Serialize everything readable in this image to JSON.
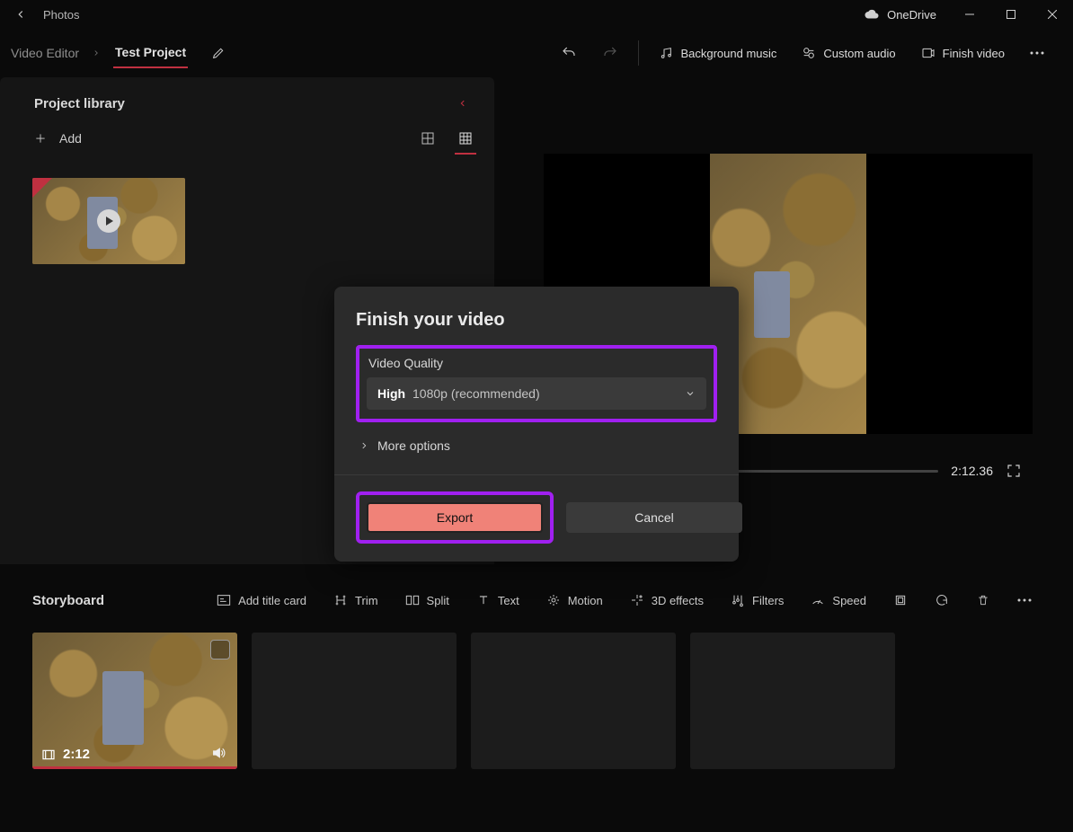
{
  "titlebar": {
    "app": "Photos",
    "onedrive": "OneDrive"
  },
  "breadcrumb": {
    "root": "Video Editor",
    "project": "Test Project"
  },
  "commands": {
    "bg_music": "Background music",
    "custom_audio": "Custom audio",
    "finish_video": "Finish video"
  },
  "library": {
    "title": "Project library",
    "add": "Add"
  },
  "preview": {
    "time": "2:12.36"
  },
  "storyboard": {
    "title": "Storyboard",
    "add_title_card": "Add title card",
    "trim": "Trim",
    "split": "Split",
    "text": "Text",
    "motion": "Motion",
    "effects3d": "3D effects",
    "filters": "Filters",
    "speed": "Speed",
    "clip_duration": "2:12"
  },
  "dialog": {
    "title": "Finish your video",
    "vq_label": "Video Quality",
    "vq_strong": "High",
    "vq_rest": "1080p (recommended)",
    "more": "More options",
    "export": "Export",
    "cancel": "Cancel"
  }
}
